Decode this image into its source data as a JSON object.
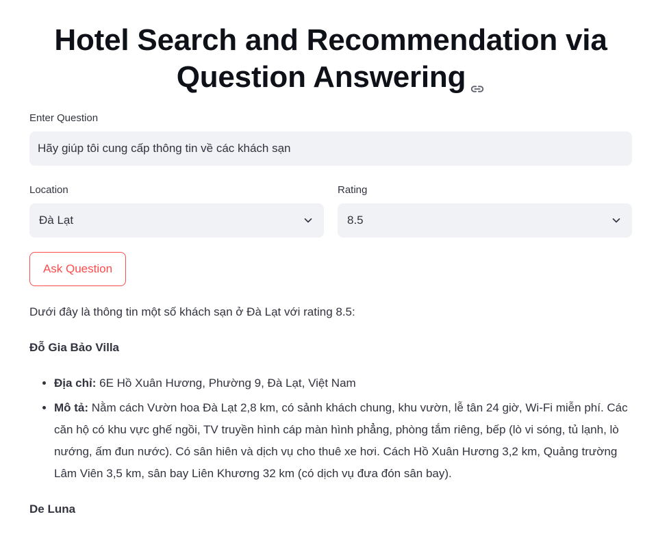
{
  "header": {
    "title": "Hotel Search and Recommendation via Question Answering",
    "anchor_icon": "link-icon"
  },
  "question": {
    "label": "Enter Question",
    "value": "Hãy giúp tôi cung cấp thông tin về các khách sạn"
  },
  "location": {
    "label": "Location",
    "selected": "Đà Lạt",
    "icon": "chevron-down-icon"
  },
  "rating": {
    "label": "Rating",
    "selected": "8.5",
    "icon": "chevron-down-icon"
  },
  "ask_button": {
    "label": "Ask Question"
  },
  "colors": {
    "accent": "#ff4b4b",
    "input_bg": "#f0f2f6",
    "text": "#31333f"
  },
  "answer": {
    "intro": "Dưới đây là thông tin một số khách sạn ở Đà Lạt với rating 8.5:",
    "hotels": [
      {
        "name": "Đỗ Gia Bảo Villa",
        "address_label": "Địa chỉ:",
        "address": "6E Hồ Xuân Hương, Phường 9, Đà Lạt, Việt Nam",
        "desc_label": "Mô tả:",
        "description": "Nằm cách Vườn hoa Đà Lạt 2,8 km, có sảnh khách chung, khu vườn, lễ tân 24 giờ, Wi-Fi miễn phí. Các căn hộ có khu vực ghế ngồi, TV truyền hình cáp màn hình phẳng, phòng tắm riêng, bếp (lò vi sóng, tủ lạnh, lò nướng, ấm đun nước). Có sân hiên và dịch vụ cho thuê xe hơi. Cách Hồ Xuân Hương 3,2 km, Quảng trường Lâm Viên 3,5 km, sân bay Liên Khương 32 km (có dịch vụ đưa đón sân bay)."
      },
      {
        "name": "De Luna"
      }
    ]
  }
}
